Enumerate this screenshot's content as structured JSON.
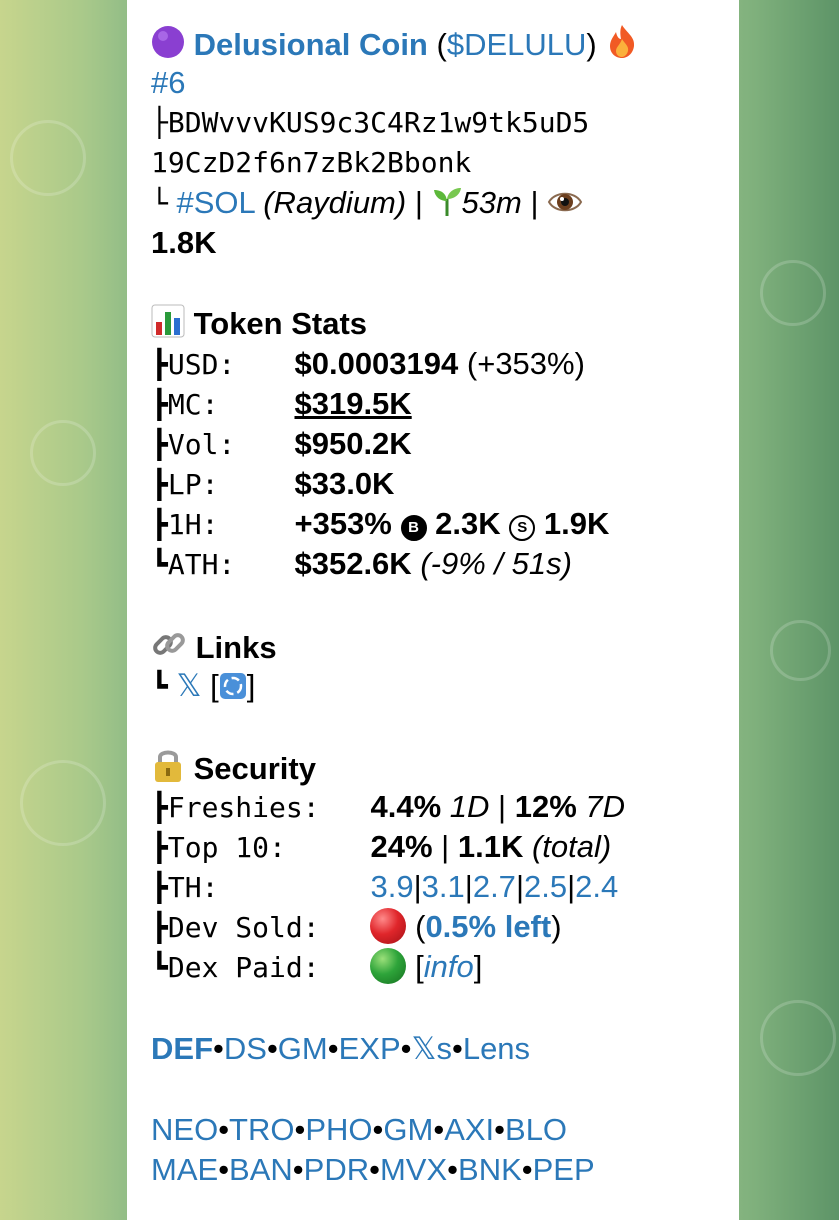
{
  "header": {
    "name": "Delusional Coin",
    "ticker": "$DELULU",
    "rank": "#6",
    "ca_line1": "├BDWvvvKUS9c3C4Rz1w9tk5uD5",
    "ca_line2": "19CzD2f6n7zBk2Bbonk",
    "chain": "#SOL",
    "dex": "(Raydium)",
    "age": "53m",
    "views": "1.8K"
  },
  "stats": {
    "title": "Token Stats",
    "usd_label": "USD:",
    "usd_value": "$0.0003194",
    "usd_change": "(+353%)",
    "mc_label": "MC:",
    "mc_value": "$319.5K",
    "vol_label": "Vol:",
    "vol_value": "$950.2K",
    "lp_label": "LP:",
    "lp_value": "$33.0K",
    "h1_label": "1H:",
    "h1_change": "+353%",
    "h1_buys": "2.3K",
    "h1_sells": "1.9K",
    "ath_label": "ATH:",
    "ath_value": "$352.6K",
    "ath_note": "(-9% / 51s)"
  },
  "links": {
    "title": "Links",
    "x_link": "𝕏"
  },
  "security": {
    "title": "Security",
    "freshies_label": "Freshies:",
    "freshies_1d": "4.4%",
    "freshies_1d_unit": "1D",
    "freshies_7d": "12%",
    "freshies_7d_unit": "7D",
    "top10_label": "Top 10:",
    "top10_pct": "24%",
    "top10_total": "1.1K",
    "top10_note": "(total)",
    "th_label": "TH:",
    "th_values": [
      "3.9",
      "3.1",
      "2.7",
      "2.5",
      "2.4"
    ],
    "dev_label": "Dev Sold:",
    "dev_left": "0.5% left",
    "dex_label": "Dex Paid:",
    "dex_info": "info"
  },
  "tools": {
    "row1": [
      "DEF",
      "DS",
      "GM",
      "EXP",
      "𝕏s",
      "Lens"
    ],
    "row2": [
      "NEO",
      "TRO",
      "PHO",
      "GM",
      "AXI",
      "BLO"
    ],
    "row3": [
      "MAE",
      "BAN",
      "PDR",
      "MVX",
      "BNK",
      "PEP"
    ]
  },
  "colors": {
    "link": "#2b78b8",
    "red": "#e0262b",
    "green": "#2ea43a",
    "purple": "#8a3fd1"
  }
}
